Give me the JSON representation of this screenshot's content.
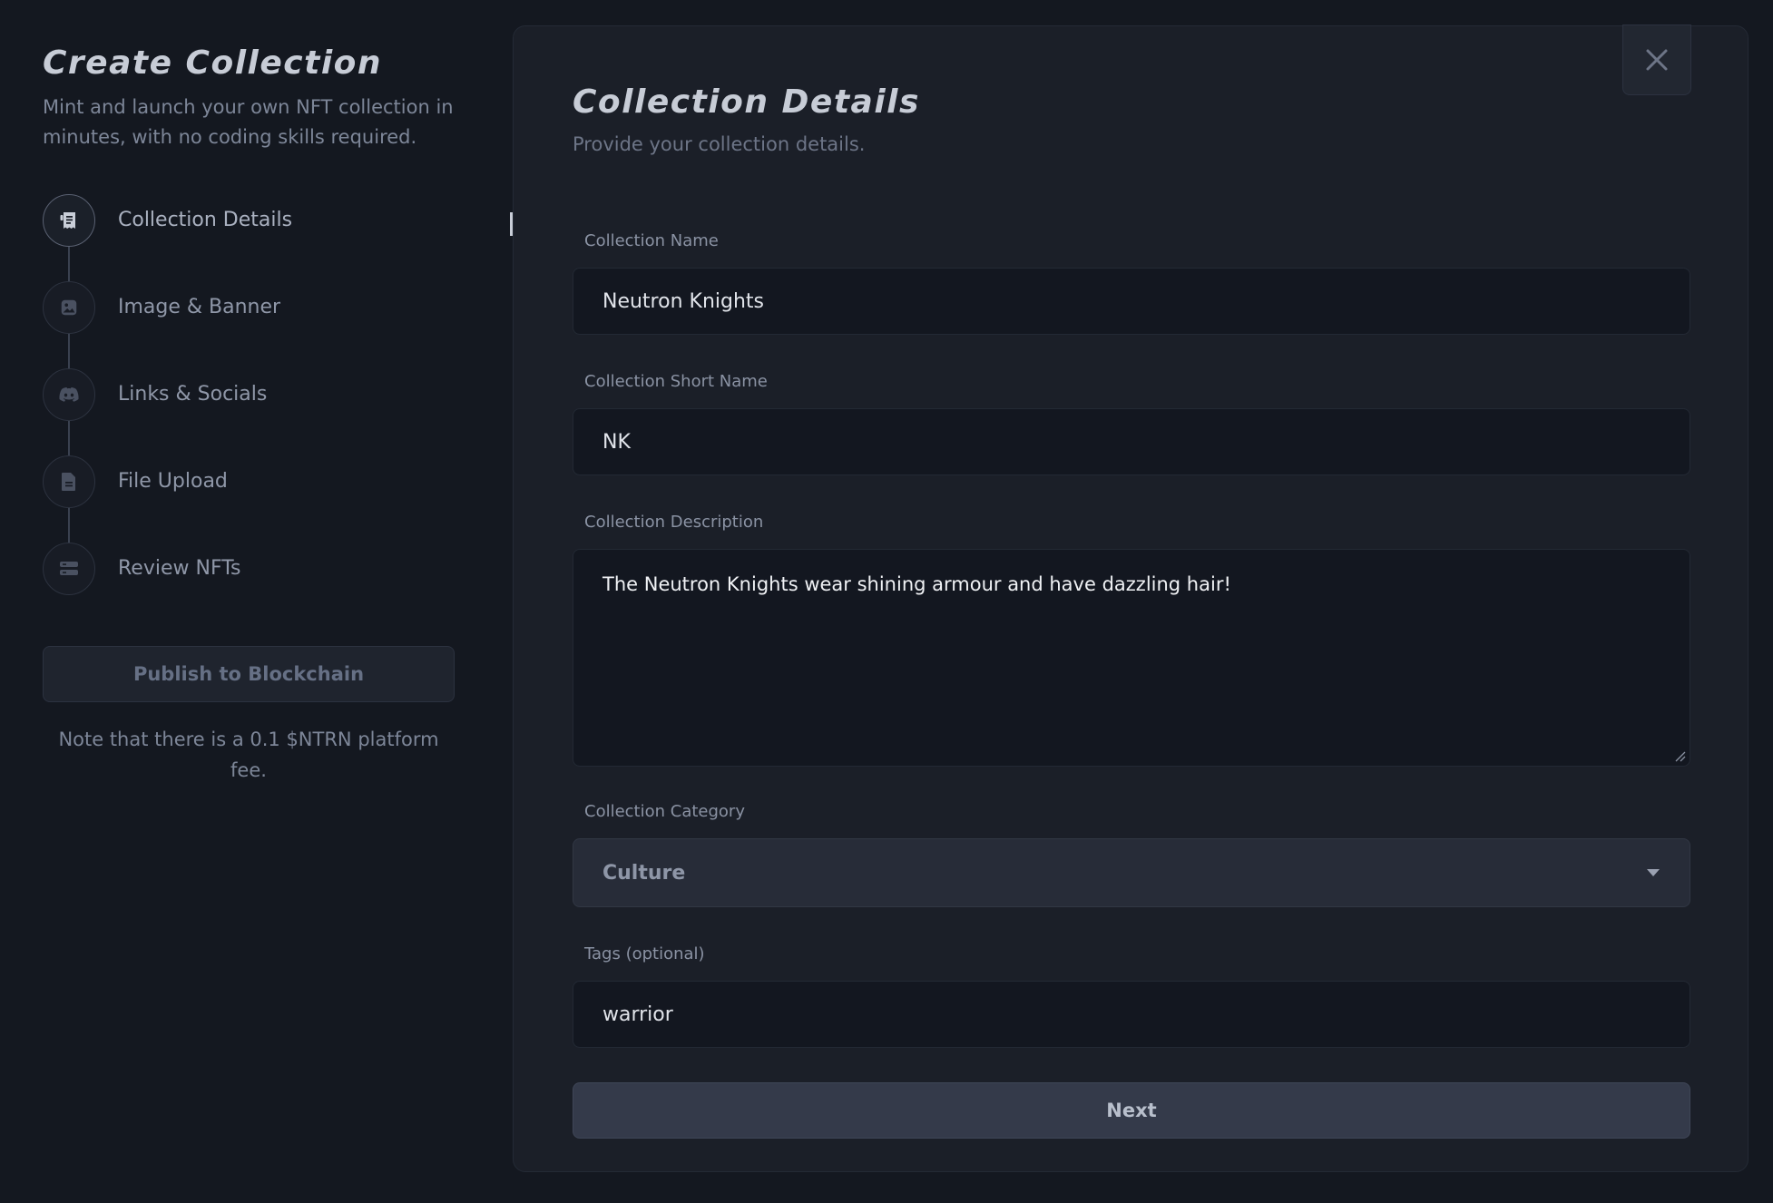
{
  "sidebar": {
    "title": "Create Collection",
    "subtitle": "Mint and launch your own NFT collection in minutes, with no coding skills required.",
    "steps": [
      {
        "label": "Collection Details",
        "icon": "receipt-icon",
        "active": true
      },
      {
        "label": "Image & Banner",
        "icon": "image-icon",
        "active": false
      },
      {
        "label": "Links & Socials",
        "icon": "discord-icon",
        "active": false
      },
      {
        "label": "File Upload",
        "icon": "file-icon",
        "active": false
      },
      {
        "label": "Review NFTs",
        "icon": "server-icon",
        "active": false
      }
    ],
    "publish_label": "Publish to Blockchain",
    "fee_note": "Note that there is a 0.1 $NTRN platform fee."
  },
  "panel": {
    "title": "Collection Details",
    "subtitle": "Provide your collection details.",
    "fields": {
      "name": {
        "label": "Collection Name",
        "value": "Neutron Knights"
      },
      "short_name": {
        "label": "Collection Short Name",
        "value": "NK"
      },
      "description": {
        "label": "Collection Description",
        "value": "The Neutron Knights wear shining armour and have dazzling hair!"
      },
      "category": {
        "label": "Collection Category",
        "value": "Culture"
      },
      "tags": {
        "label": "Tags (optional)",
        "value": "warrior"
      }
    },
    "next_label": "Next"
  },
  "colors": {
    "background": "#141820",
    "panel": "#1b1f28",
    "input": "#131720",
    "button": "#343a4a"
  }
}
